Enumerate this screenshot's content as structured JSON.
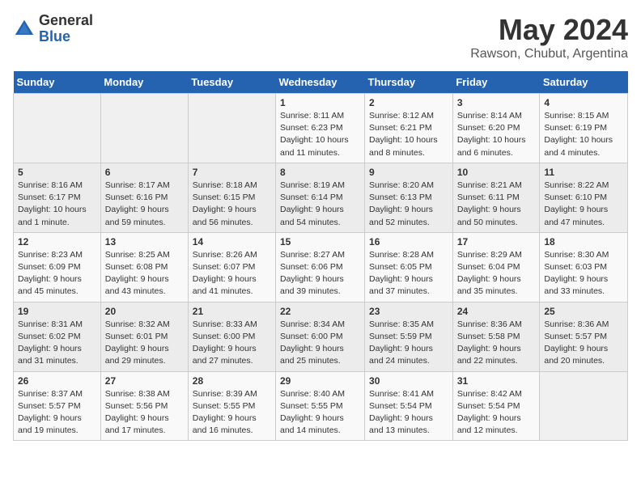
{
  "header": {
    "logo_general": "General",
    "logo_blue": "Blue",
    "main_title": "May 2024",
    "subtitle": "Rawson, Chubut, Argentina"
  },
  "days_of_week": [
    "Sunday",
    "Monday",
    "Tuesday",
    "Wednesday",
    "Thursday",
    "Friday",
    "Saturday"
  ],
  "weeks": [
    [
      {
        "day": "",
        "info": ""
      },
      {
        "day": "",
        "info": ""
      },
      {
        "day": "",
        "info": ""
      },
      {
        "day": "1",
        "info": "Sunrise: 8:11 AM\nSunset: 6:23 PM\nDaylight: 10 hours\nand 11 minutes."
      },
      {
        "day": "2",
        "info": "Sunrise: 8:12 AM\nSunset: 6:21 PM\nDaylight: 10 hours\nand 8 minutes."
      },
      {
        "day": "3",
        "info": "Sunrise: 8:14 AM\nSunset: 6:20 PM\nDaylight: 10 hours\nand 6 minutes."
      },
      {
        "day": "4",
        "info": "Sunrise: 8:15 AM\nSunset: 6:19 PM\nDaylight: 10 hours\nand 4 minutes."
      }
    ],
    [
      {
        "day": "5",
        "info": "Sunrise: 8:16 AM\nSunset: 6:17 PM\nDaylight: 10 hours\nand 1 minute."
      },
      {
        "day": "6",
        "info": "Sunrise: 8:17 AM\nSunset: 6:16 PM\nDaylight: 9 hours\nand 59 minutes."
      },
      {
        "day": "7",
        "info": "Sunrise: 8:18 AM\nSunset: 6:15 PM\nDaylight: 9 hours\nand 56 minutes."
      },
      {
        "day": "8",
        "info": "Sunrise: 8:19 AM\nSunset: 6:14 PM\nDaylight: 9 hours\nand 54 minutes."
      },
      {
        "day": "9",
        "info": "Sunrise: 8:20 AM\nSunset: 6:13 PM\nDaylight: 9 hours\nand 52 minutes."
      },
      {
        "day": "10",
        "info": "Sunrise: 8:21 AM\nSunset: 6:11 PM\nDaylight: 9 hours\nand 50 minutes."
      },
      {
        "day": "11",
        "info": "Sunrise: 8:22 AM\nSunset: 6:10 PM\nDaylight: 9 hours\nand 47 minutes."
      }
    ],
    [
      {
        "day": "12",
        "info": "Sunrise: 8:23 AM\nSunset: 6:09 PM\nDaylight: 9 hours\nand 45 minutes."
      },
      {
        "day": "13",
        "info": "Sunrise: 8:25 AM\nSunset: 6:08 PM\nDaylight: 9 hours\nand 43 minutes."
      },
      {
        "day": "14",
        "info": "Sunrise: 8:26 AM\nSunset: 6:07 PM\nDaylight: 9 hours\nand 41 minutes."
      },
      {
        "day": "15",
        "info": "Sunrise: 8:27 AM\nSunset: 6:06 PM\nDaylight: 9 hours\nand 39 minutes."
      },
      {
        "day": "16",
        "info": "Sunrise: 8:28 AM\nSunset: 6:05 PM\nDaylight: 9 hours\nand 37 minutes."
      },
      {
        "day": "17",
        "info": "Sunrise: 8:29 AM\nSunset: 6:04 PM\nDaylight: 9 hours\nand 35 minutes."
      },
      {
        "day": "18",
        "info": "Sunrise: 8:30 AM\nSunset: 6:03 PM\nDaylight: 9 hours\nand 33 minutes."
      }
    ],
    [
      {
        "day": "19",
        "info": "Sunrise: 8:31 AM\nSunset: 6:02 PM\nDaylight: 9 hours\nand 31 minutes."
      },
      {
        "day": "20",
        "info": "Sunrise: 8:32 AM\nSunset: 6:01 PM\nDaylight: 9 hours\nand 29 minutes."
      },
      {
        "day": "21",
        "info": "Sunrise: 8:33 AM\nSunset: 6:00 PM\nDaylight: 9 hours\nand 27 minutes."
      },
      {
        "day": "22",
        "info": "Sunrise: 8:34 AM\nSunset: 6:00 PM\nDaylight: 9 hours\nand 25 minutes."
      },
      {
        "day": "23",
        "info": "Sunrise: 8:35 AM\nSunset: 5:59 PM\nDaylight: 9 hours\nand 24 minutes."
      },
      {
        "day": "24",
        "info": "Sunrise: 8:36 AM\nSunset: 5:58 PM\nDaylight: 9 hours\nand 22 minutes."
      },
      {
        "day": "25",
        "info": "Sunrise: 8:36 AM\nSunset: 5:57 PM\nDaylight: 9 hours\nand 20 minutes."
      }
    ],
    [
      {
        "day": "26",
        "info": "Sunrise: 8:37 AM\nSunset: 5:57 PM\nDaylight: 9 hours\nand 19 minutes."
      },
      {
        "day": "27",
        "info": "Sunrise: 8:38 AM\nSunset: 5:56 PM\nDaylight: 9 hours\nand 17 minutes."
      },
      {
        "day": "28",
        "info": "Sunrise: 8:39 AM\nSunset: 5:55 PM\nDaylight: 9 hours\nand 16 minutes."
      },
      {
        "day": "29",
        "info": "Sunrise: 8:40 AM\nSunset: 5:55 PM\nDaylight: 9 hours\nand 14 minutes."
      },
      {
        "day": "30",
        "info": "Sunrise: 8:41 AM\nSunset: 5:54 PM\nDaylight: 9 hours\nand 13 minutes."
      },
      {
        "day": "31",
        "info": "Sunrise: 8:42 AM\nSunset: 5:54 PM\nDaylight: 9 hours\nand 12 minutes."
      },
      {
        "day": "",
        "info": ""
      }
    ]
  ]
}
